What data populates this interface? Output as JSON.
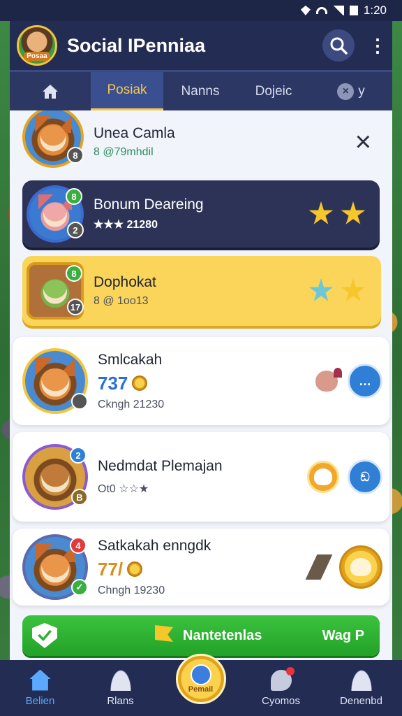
{
  "status_bar": {
    "time": "1:20"
  },
  "header": {
    "title": "Social IPenniaa",
    "avatar_label": "Posaa"
  },
  "tabs": [
    {
      "label": "Posiak",
      "active": true
    },
    {
      "label": "Nanns"
    },
    {
      "label": "Dojeic"
    },
    {
      "label": "у"
    }
  ],
  "rows": {
    "r1": {
      "name": "Unea Camla",
      "sub": "8 @79mhdil",
      "badge": "8"
    },
    "r2": {
      "name": "Bonum Deareing",
      "sub": "★★★ 21280",
      "badge_top": "8",
      "badge": "2"
    },
    "r3": {
      "name": "Dophokat",
      "sub": "8 @ 1oo13",
      "badge_top": "8",
      "badge": "17"
    },
    "r4": {
      "name": "Smlcakah",
      "score": "737",
      "sub": "Ckngh 21230"
    },
    "r5": {
      "name": "Nedmdat Plemajan",
      "sub": "Ot0 ☆☆★",
      "badge_top": "2",
      "badge": "B",
      "btn": "ඞ"
    },
    "r6": {
      "name": "Satkakah enngdk",
      "score": "77/",
      "sub": "Chngh 19230",
      "badge_top": "4"
    }
  },
  "action_bar": {
    "label": "Nantetenlas",
    "right": "Wag P"
  },
  "bottom_nav": [
    {
      "label": "Belien",
      "active": true
    },
    {
      "label": "Rlans"
    },
    {
      "label": "Pemail"
    },
    {
      "label": "Cyomos"
    },
    {
      "label": "Denenbd"
    }
  ],
  "colors": {
    "accent": "#f6c94a",
    "primary": "#2f7fd6",
    "header": "#232c52",
    "action": "#22a228"
  }
}
